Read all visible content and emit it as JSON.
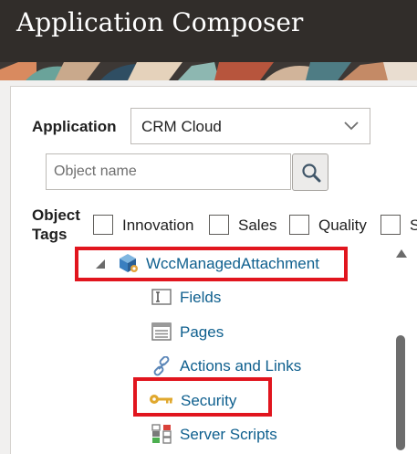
{
  "header": {
    "title": "Application Composer"
  },
  "filters": {
    "application_label": "Application",
    "application_value": "CRM Cloud",
    "search_placeholder": "Object name",
    "object_tags_label_line1": "Object",
    "object_tags_label_line2": "Tags",
    "tags": [
      "Innovation",
      "Sales",
      "Quality",
      "S"
    ]
  },
  "tree": {
    "object": {
      "label": "WccManagedAttachment",
      "icon": "object-cube-icon"
    },
    "children": [
      {
        "label": "Fields",
        "icon": "fields-icon"
      },
      {
        "label": "Pages",
        "icon": "pages-icon"
      },
      {
        "label": "Actions and Links",
        "icon": "link-icon"
      },
      {
        "label": "Security",
        "icon": "key-icon"
      },
      {
        "label": "Server Scripts",
        "icon": "server-scripts-icon"
      }
    ]
  },
  "colors": {
    "header_bg": "#312d2a",
    "link": "#0e5f8e",
    "highlight": "#e1151e"
  }
}
